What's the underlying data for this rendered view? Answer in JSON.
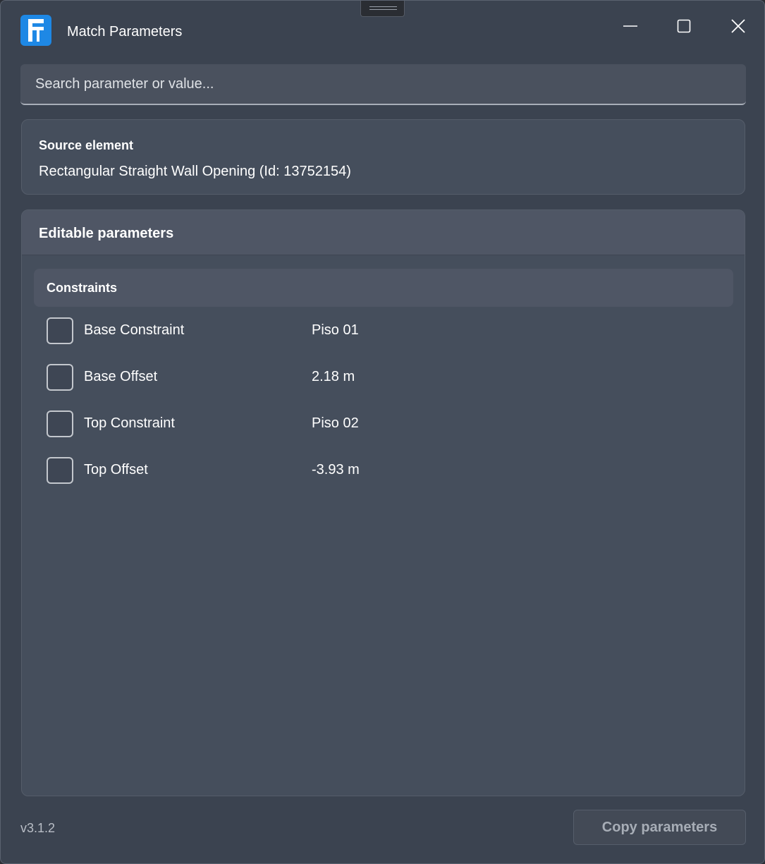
{
  "window": {
    "title": "Match Parameters",
    "accent_color": "#1e88e5"
  },
  "search": {
    "placeholder": "Search parameter or value..."
  },
  "source": {
    "label": "Source element",
    "value": "Rectangular Straight Wall Opening (Id: 13752154)"
  },
  "editable": {
    "title": "Editable parameters",
    "groups": [
      {
        "name": "Constraints",
        "params": [
          {
            "name": "Base Constraint",
            "value": "Piso 01",
            "checked": false
          },
          {
            "name": "Base Offset",
            "value": "2.18 m",
            "checked": false
          },
          {
            "name": "Top Constraint",
            "value": "Piso 02",
            "checked": false
          },
          {
            "name": "Top Offset",
            "value": "-3.93 m",
            "checked": false
          }
        ]
      }
    ]
  },
  "footer": {
    "version": "v3.1.2",
    "copy_label": "Copy parameters"
  }
}
